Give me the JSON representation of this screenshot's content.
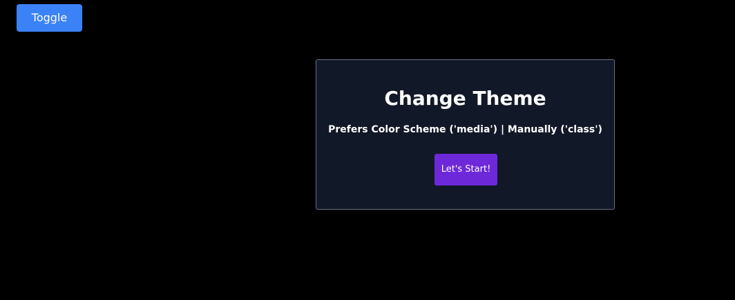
{
  "toggle": {
    "label": "Toggle"
  },
  "card": {
    "title": "Change Theme",
    "subtitle": "Prefers Color Scheme ('media') | Manually ('class')",
    "start_label": "Let's Start!"
  },
  "colors": {
    "background": "#000000",
    "card_background": "#111827",
    "card_border": "#6b7280",
    "toggle_button": "#3b82f6",
    "start_button": "#6d28d9",
    "text": "#ffffff"
  }
}
